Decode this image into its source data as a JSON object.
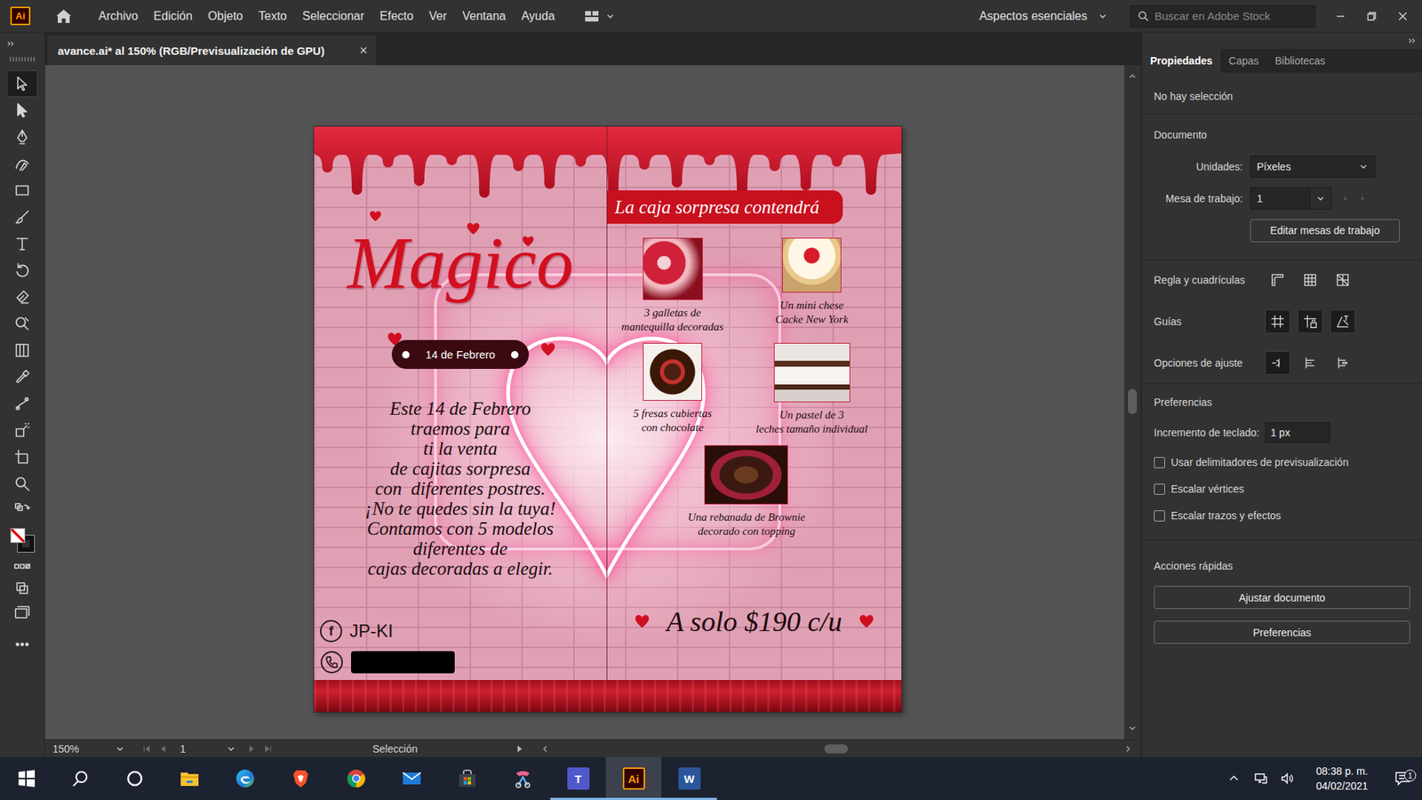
{
  "window": {
    "logo": "Ai",
    "menu": [
      "Archivo",
      "Edición",
      "Objeto",
      "Texto",
      "Seleccionar",
      "Efecto",
      "Ver",
      "Ventana",
      "Ayuda"
    ],
    "workspace": "Aspectos esenciales",
    "search": {
      "placeholder": "Buscar en Adobe Stock"
    }
  },
  "document_tab": {
    "title": "avance.ai* al 150% (RGB/Previsualización de GPU)",
    "close": "×"
  },
  "tools": [
    {
      "kind": "selection",
      "selected": true
    },
    {
      "kind": "direct-selection",
      "selected": false
    },
    {
      "kind": "pen",
      "selected": false
    },
    {
      "kind": "curvature",
      "selected": false
    },
    {
      "kind": "rectangle",
      "selected": false
    },
    {
      "kind": "paintbrush",
      "selected": false
    },
    {
      "kind": "type",
      "selected": false
    },
    {
      "kind": "rotate",
      "selected": false
    },
    {
      "kind": "eraser",
      "selected": false
    },
    {
      "kind": "shape-builder",
      "selected": false
    },
    {
      "kind": "gradient",
      "selected": false
    },
    {
      "kind": "eyedropper",
      "selected": false
    },
    {
      "kind": "puppet-warp",
      "selected": false
    },
    {
      "kind": "symbol-sprayer",
      "selected": false
    },
    {
      "kind": "artboard",
      "selected": false
    },
    {
      "kind": "zoom",
      "selected": false
    },
    {
      "kind": "swap-colors",
      "selected": false
    },
    {
      "kind": "fill-stroke",
      "selected": false
    },
    {
      "kind": "color-modes",
      "selected": false
    },
    {
      "kind": "draw-mode",
      "selected": false
    },
    {
      "kind": "screen-mode",
      "selected": false
    },
    {
      "kind": "more",
      "selected": false
    }
  ],
  "flyer": {
    "title": "Magico",
    "date": "14 de Febrero",
    "body": [
      "Este 14 de Febrero",
      "traemos para",
      "ti la venta",
      "de cajitas sorpresa",
      "con  diferentes postres.",
      "¡No te quedes sin la tuya!",
      "Contamos con 5 modelos",
      "diferentes de",
      "cajas decoradas a elegir."
    ],
    "facebook": {
      "icon": "f",
      "label": "JP-KI"
    },
    "phone": {
      "redacted": true
    },
    "banner": "La caja sorpresa contendrá",
    "items": [
      {
        "caption": [
          "3 galletas de",
          "mantequilla decoradas"
        ]
      },
      {
        "caption": [
          "Un mini chese",
          "Cacke New York"
        ]
      },
      {
        "caption": [
          "5 fresas cubiertas",
          "con chocolate"
        ]
      },
      {
        "caption": [
          "Un pastel de 3",
          "leches tamaño individual"
        ]
      },
      {
        "caption": [
          "Una rebanada de Brownie",
          "decorado con topping"
        ]
      }
    ],
    "price": "A solo $190 c/u"
  },
  "panel": {
    "tabs": [
      {
        "label": "Propiedades",
        "selected": true
      },
      {
        "label": "Capas",
        "selected": false
      },
      {
        "label": "Bibliotecas",
        "selected": false
      }
    ],
    "no_selection": "No hay selección",
    "document": {
      "title": "Documento",
      "units_label": "Unidades:",
      "units": "Píxeles",
      "artboard_label": "Mesa de trabajo:",
      "artboard": "1",
      "edit_button": "Editar mesas de trabajo"
    },
    "rulers": {
      "title": "Regla y cuadrículas",
      "toggles": [
        {
          "kind": "rulers",
          "on": false
        },
        {
          "kind": "grid",
          "on": false
        },
        {
          "kind": "transparency-grid",
          "on": false
        }
      ]
    },
    "guides": {
      "title": "Guías",
      "toggles": [
        {
          "kind": "guides",
          "on": true
        },
        {
          "kind": "lock-guides",
          "on": true
        },
        {
          "kind": "smart-guides",
          "on": true
        }
      ]
    },
    "snap": {
      "title": "Opciones de ajuste",
      "toggles": [
        {
          "kind": "snap-point",
          "on": true
        },
        {
          "kind": "snap-grid",
          "on": false
        },
        {
          "kind": "snap-pixel",
          "on": false
        }
      ]
    },
    "preferences": {
      "title": "Preferencias",
      "increment_label": "Incremento de teclado:",
      "increment": "1 px",
      "checks": [
        {
          "label": "Usar delimitadores de previsualización",
          "checked": false
        },
        {
          "label": "Escalar vértices",
          "checked": false
        },
        {
          "label": "Escalar trazos y efectos",
          "checked": false
        }
      ]
    },
    "quick_actions": {
      "title": "Acciones rápidas",
      "buttons": [
        "Ajustar documento",
        "Preferencias"
      ]
    }
  },
  "status_bar": {
    "zoom": "150%",
    "artboard": "1",
    "tool": "Selección"
  },
  "taskbar": {
    "apps": [
      {
        "kind": "start",
        "open": false,
        "active": false
      },
      {
        "kind": "search",
        "open": false,
        "active": false
      },
      {
        "kind": "cortana",
        "open": false,
        "active": false
      },
      {
        "kind": "explorer",
        "open": false,
        "active": false
      },
      {
        "kind": "edge",
        "open": false,
        "active": false
      },
      {
        "kind": "brave",
        "open": false,
        "active": false
      },
      {
        "kind": "chrome",
        "open": false,
        "active": false
      },
      {
        "kind": "mail",
        "open": false,
        "active": false
      },
      {
        "kind": "store",
        "open": false,
        "active": false
      },
      {
        "kind": "snip",
        "open": false,
        "active": false
      },
      {
        "kind": "teams",
        "label": "T",
        "open": true,
        "active": false
      },
      {
        "kind": "illustrator",
        "label": "Ai",
        "open": true,
        "active": true
      },
      {
        "kind": "word",
        "label": "W",
        "open": true,
        "active": false
      }
    ],
    "time": "08:38 p. m.",
    "date": "04/02/2021",
    "notifications": "1"
  }
}
